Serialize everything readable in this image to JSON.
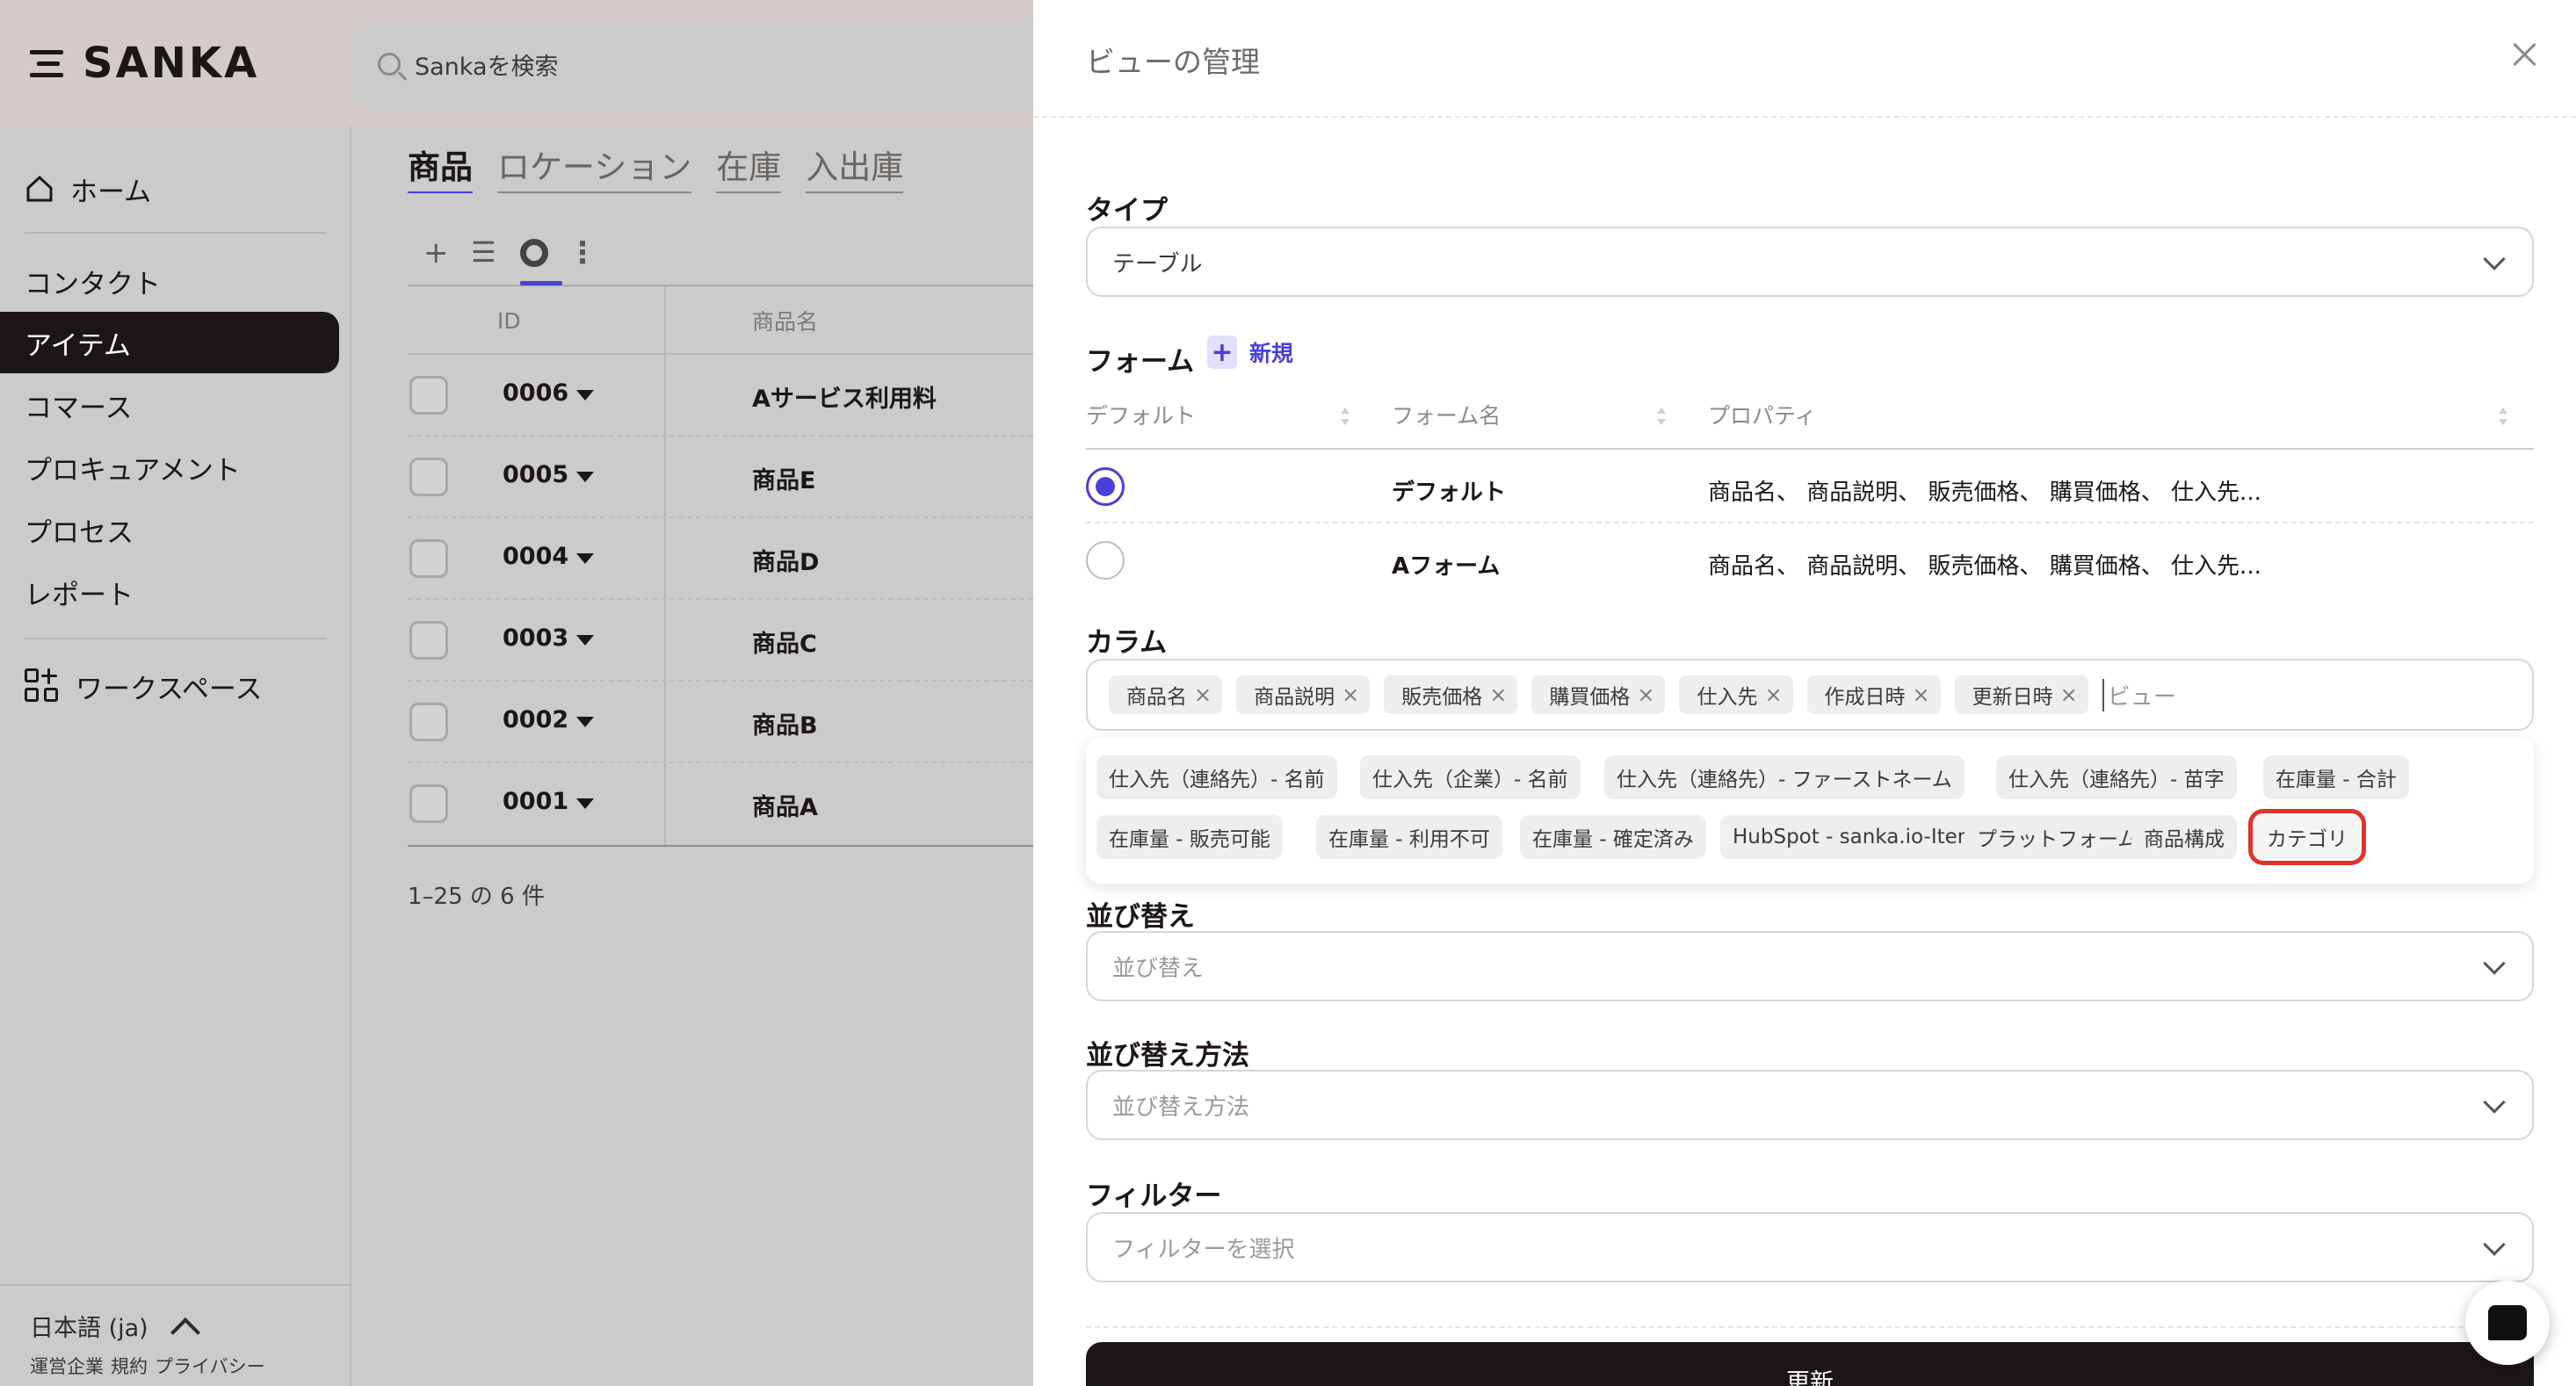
{
  "app": {
    "logo": "SANKA",
    "search_placeholder": "Sankaを検索"
  },
  "sidebar": {
    "home": "ホーム",
    "items": [
      {
        "label": "コンタクト",
        "active": false
      },
      {
        "label": "アイテム",
        "active": true
      },
      {
        "label": "コマース",
        "active": false
      },
      {
        "label": "プロキュアメント",
        "active": false
      },
      {
        "label": "プロセス",
        "active": false
      },
      {
        "label": "レポート",
        "active": false
      }
    ],
    "workspace": "ワークスペース",
    "language": "日本語 (ja)",
    "footer_links": [
      "運営企業",
      "規約",
      "プライバシー"
    ]
  },
  "main": {
    "tabs": [
      "商品",
      "ロケーション",
      "在庫",
      "入出庫"
    ],
    "table_headers": {
      "id": "ID",
      "name": "商品名"
    },
    "rows": [
      {
        "id": "0006",
        "name": "Aサービス利用料"
      },
      {
        "id": "0005",
        "name": "商品E"
      },
      {
        "id": "0004",
        "name": "商品D"
      },
      {
        "id": "0003",
        "name": "商品C"
      },
      {
        "id": "0002",
        "name": "商品B"
      },
      {
        "id": "0001",
        "name": "商品A"
      }
    ],
    "pager": "1–25 の 6 件"
  },
  "modal": {
    "title": "ビューの管理",
    "type_label": "タイプ",
    "type_value": "テーブル",
    "form_label": "フォーム",
    "new_label": "新規",
    "form_headers": {
      "default": "デフォルト",
      "name": "フォーム名",
      "props": "プロパティ"
    },
    "forms": [
      {
        "name": "デフォルト",
        "props": "商品名、 商品説明、 販売価格、 購買価格、 仕入先...",
        "selected": true
      },
      {
        "name": "Aフォーム",
        "props": "商品名、 商品説明、 販売価格、 購買価格、 仕入先...",
        "selected": false
      }
    ],
    "column_label": "カラム",
    "selected_columns": [
      "商品名",
      "商品説明",
      "販売価格",
      "購買価格",
      "仕入先",
      "作成日時",
      "更新日時"
    ],
    "column_input_placeholder": "ビュー",
    "column_options": [
      "仕入先（連絡先）- 名前",
      "仕入先（企業）- 名前",
      "仕入先（連絡先）- ファーストネーム",
      "仕入先（連絡先）- 苗字",
      "在庫量 - 合計",
      "在庫量 - 販売可能",
      "在庫量 - 利用不可",
      "在庫量 - 確定済み",
      "HubSpot - sanka.io-Item ID",
      "プラットフォームID",
      "商品構成",
      "カテゴリ"
    ],
    "highlighted_option": "カテゴリ",
    "sort_label": "並び替え",
    "sort_placeholder": "並び替え",
    "sort_method_label": "並び替え方法",
    "sort_method_placeholder": "並び替え方法",
    "filter_label": "フィルター",
    "filter_placeholder": "フィルターを選択",
    "update_button": "更新"
  },
  "colors": {
    "accent": "#4a3fd6",
    "dark": "#1c1716",
    "highlight": "#e0322a"
  }
}
